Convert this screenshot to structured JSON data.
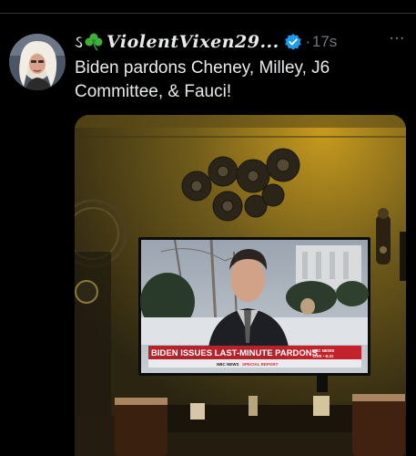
{
  "tweet": {
    "username": "ViolentVixen29...",
    "time": "17s",
    "dot": "·",
    "more": "···",
    "text": "Biden pardons Cheney, Milley, J6 Committee, & Fauci!"
  },
  "media": {
    "headline": "BIDEN ISSUES LAST-MINUTE PARDONS",
    "network": "NBC NEWS",
    "live": "LIVE • 6:41",
    "subline_network": "NBC NEWS",
    "subline_report": "SPECIAL REPORT"
  },
  "colors": {
    "background": "#000000",
    "text": "#e7e9ea",
    "muted": "#71767b",
    "verified": "#1d9bf0",
    "chyron_red": "#b4222b"
  },
  "icons": {
    "verified": "verified-badge-icon",
    "more": "more-options-icon",
    "clover": "shamrock-icon"
  }
}
